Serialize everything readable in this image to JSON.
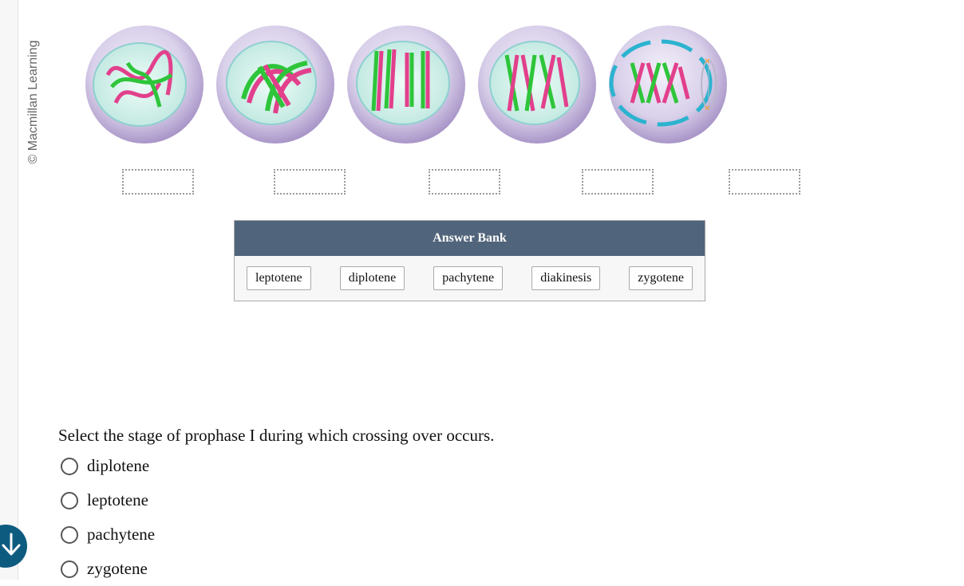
{
  "credit": "© Macmillan Learning",
  "answer_bank": {
    "title": "Answer Bank",
    "items": [
      "leptotene",
      "diplotene",
      "pachytene",
      "diakinesis",
      "zygotene"
    ]
  },
  "question": {
    "prompt": "Select the stage of prophase I during which crossing over occurs.",
    "options": [
      "diplotene",
      "leptotene",
      "pachytene",
      "zygotene"
    ]
  },
  "colors": {
    "chromosome_pink": "#e2408c",
    "chromosome_green": "#2ec53a",
    "cell_purple": "#bcaed6",
    "nucleus_mint": "#dff5ee",
    "header_slate": "#50647b",
    "fab_blue": "#0e5b80"
  },
  "icons": {
    "fab": "arrow-down-icon"
  }
}
